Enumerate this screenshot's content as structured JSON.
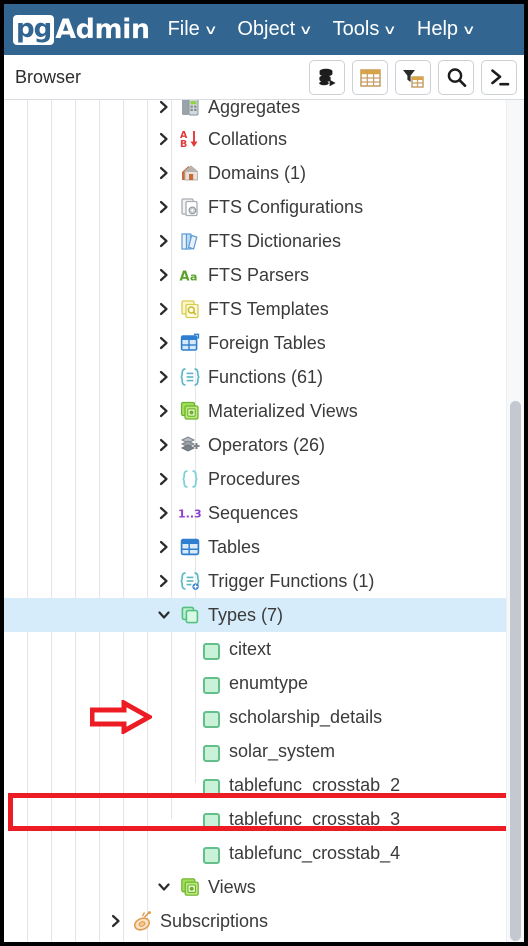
{
  "app": {
    "brand_pg": "pg",
    "brand_admin": "Admin",
    "header_bg": "#326690",
    "accent_selected_bg": "#d6ecfa",
    "annotation_color": "#ed1c24"
  },
  "menubar": [
    {
      "label": "File",
      "caret": "∨",
      "name": "menu-file"
    },
    {
      "label": "Object",
      "caret": "∨",
      "name": "menu-object"
    },
    {
      "label": "Tools",
      "caret": "∨",
      "name": "menu-tools"
    },
    {
      "label": "Help",
      "caret": "∨",
      "name": "menu-help"
    }
  ],
  "browser": {
    "title": "Browser",
    "toolbar": [
      {
        "name": "object-explorer-icon",
        "title": "Object Explorer"
      },
      {
        "name": "view-data-grid-icon",
        "title": "View Data"
      },
      {
        "name": "filtered-rows-icon",
        "title": "Filtered Rows"
      },
      {
        "name": "search-icon",
        "title": "Search Objects"
      },
      {
        "name": "query-tool-terminal-icon",
        "title": "Query Tool"
      }
    ]
  },
  "tree": {
    "rows": [
      {
        "label": "Aggregates",
        "icon": "aggregates-icon",
        "state": "collapsed",
        "depth": 5,
        "partial": true
      },
      {
        "label": "Collations",
        "icon": "collations-icon",
        "state": "collapsed",
        "depth": 5
      },
      {
        "label": "Domains (1)",
        "icon": "domains-icon",
        "state": "collapsed",
        "depth": 5
      },
      {
        "label": "FTS Configurations",
        "icon": "fts-configurations-icon",
        "state": "collapsed",
        "depth": 5
      },
      {
        "label": "FTS Dictionaries",
        "icon": "fts-dictionaries-icon",
        "state": "collapsed",
        "depth": 5
      },
      {
        "label": "FTS Parsers",
        "icon": "fts-parsers-icon",
        "state": "collapsed",
        "depth": 5
      },
      {
        "label": "FTS Templates",
        "icon": "fts-templates-icon",
        "state": "collapsed",
        "depth": 5
      },
      {
        "label": "Foreign Tables",
        "icon": "foreign-tables-icon",
        "state": "collapsed",
        "depth": 5
      },
      {
        "label": "Functions (61)",
        "icon": "functions-icon",
        "state": "collapsed",
        "depth": 5
      },
      {
        "label": "Materialized Views",
        "icon": "materialized-views-icon",
        "state": "collapsed",
        "depth": 5
      },
      {
        "label": "Operators (26)",
        "icon": "operators-icon",
        "state": "collapsed",
        "depth": 5
      },
      {
        "label": "Procedures",
        "icon": "procedures-icon",
        "state": "collapsed",
        "depth": 5
      },
      {
        "label": "Sequences",
        "icon": "sequences-icon",
        "state": "collapsed",
        "depth": 5
      },
      {
        "label": "Tables",
        "icon": "tables-icon",
        "state": "collapsed",
        "depth": 5
      },
      {
        "label": "Trigger Functions (1)",
        "icon": "trigger-functions-icon",
        "state": "collapsed",
        "depth": 5
      },
      {
        "label": "Types (7)",
        "icon": "types-icon",
        "state": "expanded",
        "depth": 5,
        "selected": true
      },
      {
        "label": "citext",
        "icon": "type-item-icon",
        "state": "leaf",
        "depth": 6
      },
      {
        "label": "enumtype",
        "icon": "type-item-icon",
        "state": "leaf",
        "depth": 6
      },
      {
        "label": "scholarship_details",
        "icon": "type-item-icon",
        "state": "leaf",
        "depth": 6,
        "highlighted": true
      },
      {
        "label": "solar_system",
        "icon": "type-item-icon",
        "state": "leaf",
        "depth": 6
      },
      {
        "label": "tablefunc_crosstab_2",
        "icon": "type-item-icon",
        "state": "leaf",
        "depth": 6
      },
      {
        "label": "tablefunc_crosstab_3",
        "icon": "type-item-icon",
        "state": "leaf",
        "depth": 6
      },
      {
        "label": "tablefunc_crosstab_4",
        "icon": "type-item-icon",
        "state": "leaf",
        "depth": 6
      },
      {
        "label": "Views",
        "icon": "views-icon",
        "state": "expanded",
        "depth": 5
      },
      {
        "label": "Subscriptions",
        "icon": "subscriptions-icon",
        "state": "collapsed",
        "depth": 4
      }
    ]
  },
  "annotations": {
    "arrow_target": "Types (7)",
    "box_target": "scholarship_details"
  },
  "scrollbar": {
    "orientation": "vertical",
    "thumb_position": "bottom"
  }
}
